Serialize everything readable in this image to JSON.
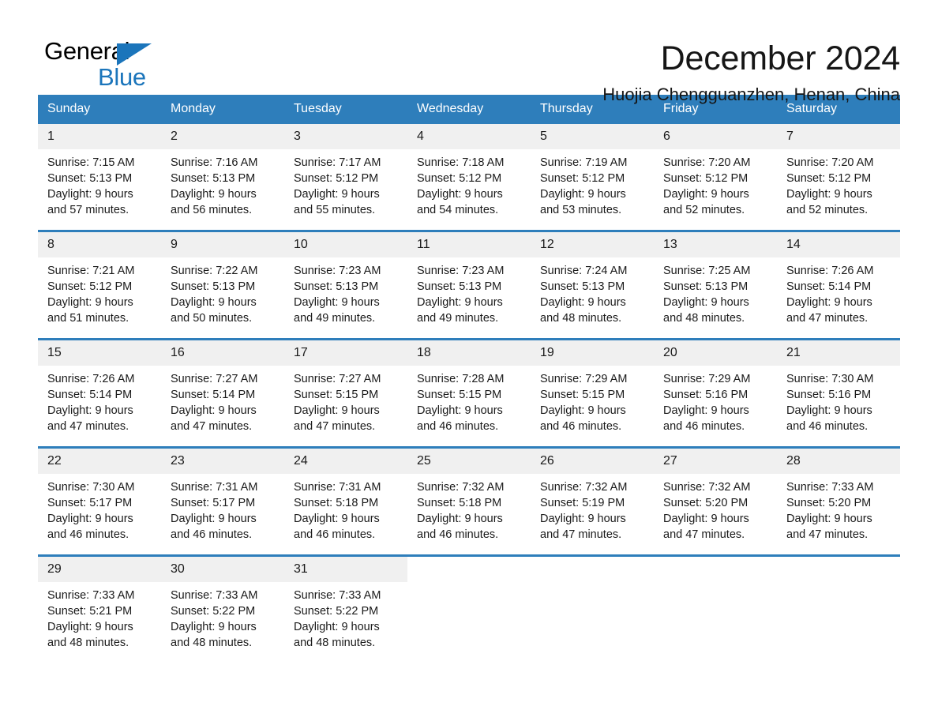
{
  "logo": {
    "word_one": "General",
    "word_two": "Blue",
    "triangle_color": "#1b75bb"
  },
  "header": {
    "month_title": "December 2024",
    "location": "Huojia Chengguanzhen, Henan, China"
  },
  "theme": {
    "header_blue": "#2e7ebb",
    "day_band_gray": "#f0f0f0",
    "text": "#1a1a1a"
  },
  "weekdays": [
    "Sunday",
    "Monday",
    "Tuesday",
    "Wednesday",
    "Thursday",
    "Friday",
    "Saturday"
  ],
  "weeks": [
    [
      {
        "day": "1",
        "sunrise": "Sunrise: 7:15 AM",
        "sunset": "Sunset: 5:13 PM",
        "daylight_line1": "Daylight: 9 hours",
        "daylight_line2": "and 57 minutes."
      },
      {
        "day": "2",
        "sunrise": "Sunrise: 7:16 AM",
        "sunset": "Sunset: 5:13 PM",
        "daylight_line1": "Daylight: 9 hours",
        "daylight_line2": "and 56 minutes."
      },
      {
        "day": "3",
        "sunrise": "Sunrise: 7:17 AM",
        "sunset": "Sunset: 5:12 PM",
        "daylight_line1": "Daylight: 9 hours",
        "daylight_line2": "and 55 minutes."
      },
      {
        "day": "4",
        "sunrise": "Sunrise: 7:18 AM",
        "sunset": "Sunset: 5:12 PM",
        "daylight_line1": "Daylight: 9 hours",
        "daylight_line2": "and 54 minutes."
      },
      {
        "day": "5",
        "sunrise": "Sunrise: 7:19 AM",
        "sunset": "Sunset: 5:12 PM",
        "daylight_line1": "Daylight: 9 hours",
        "daylight_line2": "and 53 minutes."
      },
      {
        "day": "6",
        "sunrise": "Sunrise: 7:20 AM",
        "sunset": "Sunset: 5:12 PM",
        "daylight_line1": "Daylight: 9 hours",
        "daylight_line2": "and 52 minutes."
      },
      {
        "day": "7",
        "sunrise": "Sunrise: 7:20 AM",
        "sunset": "Sunset: 5:12 PM",
        "daylight_line1": "Daylight: 9 hours",
        "daylight_line2": "and 52 minutes."
      }
    ],
    [
      {
        "day": "8",
        "sunrise": "Sunrise: 7:21 AM",
        "sunset": "Sunset: 5:12 PM",
        "daylight_line1": "Daylight: 9 hours",
        "daylight_line2": "and 51 minutes."
      },
      {
        "day": "9",
        "sunrise": "Sunrise: 7:22 AM",
        "sunset": "Sunset: 5:13 PM",
        "daylight_line1": "Daylight: 9 hours",
        "daylight_line2": "and 50 minutes."
      },
      {
        "day": "10",
        "sunrise": "Sunrise: 7:23 AM",
        "sunset": "Sunset: 5:13 PM",
        "daylight_line1": "Daylight: 9 hours",
        "daylight_line2": "and 49 minutes."
      },
      {
        "day": "11",
        "sunrise": "Sunrise: 7:23 AM",
        "sunset": "Sunset: 5:13 PM",
        "daylight_line1": "Daylight: 9 hours",
        "daylight_line2": "and 49 minutes."
      },
      {
        "day": "12",
        "sunrise": "Sunrise: 7:24 AM",
        "sunset": "Sunset: 5:13 PM",
        "daylight_line1": "Daylight: 9 hours",
        "daylight_line2": "and 48 minutes."
      },
      {
        "day": "13",
        "sunrise": "Sunrise: 7:25 AM",
        "sunset": "Sunset: 5:13 PM",
        "daylight_line1": "Daylight: 9 hours",
        "daylight_line2": "and 48 minutes."
      },
      {
        "day": "14",
        "sunrise": "Sunrise: 7:26 AM",
        "sunset": "Sunset: 5:14 PM",
        "daylight_line1": "Daylight: 9 hours",
        "daylight_line2": "and 47 minutes."
      }
    ],
    [
      {
        "day": "15",
        "sunrise": "Sunrise: 7:26 AM",
        "sunset": "Sunset: 5:14 PM",
        "daylight_line1": "Daylight: 9 hours",
        "daylight_line2": "and 47 minutes."
      },
      {
        "day": "16",
        "sunrise": "Sunrise: 7:27 AM",
        "sunset": "Sunset: 5:14 PM",
        "daylight_line1": "Daylight: 9 hours",
        "daylight_line2": "and 47 minutes."
      },
      {
        "day": "17",
        "sunrise": "Sunrise: 7:27 AM",
        "sunset": "Sunset: 5:15 PM",
        "daylight_line1": "Daylight: 9 hours",
        "daylight_line2": "and 47 minutes."
      },
      {
        "day": "18",
        "sunrise": "Sunrise: 7:28 AM",
        "sunset": "Sunset: 5:15 PM",
        "daylight_line1": "Daylight: 9 hours",
        "daylight_line2": "and 46 minutes."
      },
      {
        "day": "19",
        "sunrise": "Sunrise: 7:29 AM",
        "sunset": "Sunset: 5:15 PM",
        "daylight_line1": "Daylight: 9 hours",
        "daylight_line2": "and 46 minutes."
      },
      {
        "day": "20",
        "sunrise": "Sunrise: 7:29 AM",
        "sunset": "Sunset: 5:16 PM",
        "daylight_line1": "Daylight: 9 hours",
        "daylight_line2": "and 46 minutes."
      },
      {
        "day": "21",
        "sunrise": "Sunrise: 7:30 AM",
        "sunset": "Sunset: 5:16 PM",
        "daylight_line1": "Daylight: 9 hours",
        "daylight_line2": "and 46 minutes."
      }
    ],
    [
      {
        "day": "22",
        "sunrise": "Sunrise: 7:30 AM",
        "sunset": "Sunset: 5:17 PM",
        "daylight_line1": "Daylight: 9 hours",
        "daylight_line2": "and 46 minutes."
      },
      {
        "day": "23",
        "sunrise": "Sunrise: 7:31 AM",
        "sunset": "Sunset: 5:17 PM",
        "daylight_line1": "Daylight: 9 hours",
        "daylight_line2": "and 46 minutes."
      },
      {
        "day": "24",
        "sunrise": "Sunrise: 7:31 AM",
        "sunset": "Sunset: 5:18 PM",
        "daylight_line1": "Daylight: 9 hours",
        "daylight_line2": "and 46 minutes."
      },
      {
        "day": "25",
        "sunrise": "Sunrise: 7:32 AM",
        "sunset": "Sunset: 5:18 PM",
        "daylight_line1": "Daylight: 9 hours",
        "daylight_line2": "and 46 minutes."
      },
      {
        "day": "26",
        "sunrise": "Sunrise: 7:32 AM",
        "sunset": "Sunset: 5:19 PM",
        "daylight_line1": "Daylight: 9 hours",
        "daylight_line2": "and 47 minutes."
      },
      {
        "day": "27",
        "sunrise": "Sunrise: 7:32 AM",
        "sunset": "Sunset: 5:20 PM",
        "daylight_line1": "Daylight: 9 hours",
        "daylight_line2": "and 47 minutes."
      },
      {
        "day": "28",
        "sunrise": "Sunrise: 7:33 AM",
        "sunset": "Sunset: 5:20 PM",
        "daylight_line1": "Daylight: 9 hours",
        "daylight_line2": "and 47 minutes."
      }
    ],
    [
      {
        "day": "29",
        "sunrise": "Sunrise: 7:33 AM",
        "sunset": "Sunset: 5:21 PM",
        "daylight_line1": "Daylight: 9 hours",
        "daylight_line2": "and 48 minutes."
      },
      {
        "day": "30",
        "sunrise": "Sunrise: 7:33 AM",
        "sunset": "Sunset: 5:22 PM",
        "daylight_line1": "Daylight: 9 hours",
        "daylight_line2": "and 48 minutes."
      },
      {
        "day": "31",
        "sunrise": "Sunrise: 7:33 AM",
        "sunset": "Sunset: 5:22 PM",
        "daylight_line1": "Daylight: 9 hours",
        "daylight_line2": "and 48 minutes."
      },
      {
        "day": "",
        "sunrise": "",
        "sunset": "",
        "daylight_line1": "",
        "daylight_line2": ""
      },
      {
        "day": "",
        "sunrise": "",
        "sunset": "",
        "daylight_line1": "",
        "daylight_line2": ""
      },
      {
        "day": "",
        "sunrise": "",
        "sunset": "",
        "daylight_line1": "",
        "daylight_line2": ""
      },
      {
        "day": "",
        "sunrise": "",
        "sunset": "",
        "daylight_line1": "",
        "daylight_line2": ""
      }
    ]
  ]
}
